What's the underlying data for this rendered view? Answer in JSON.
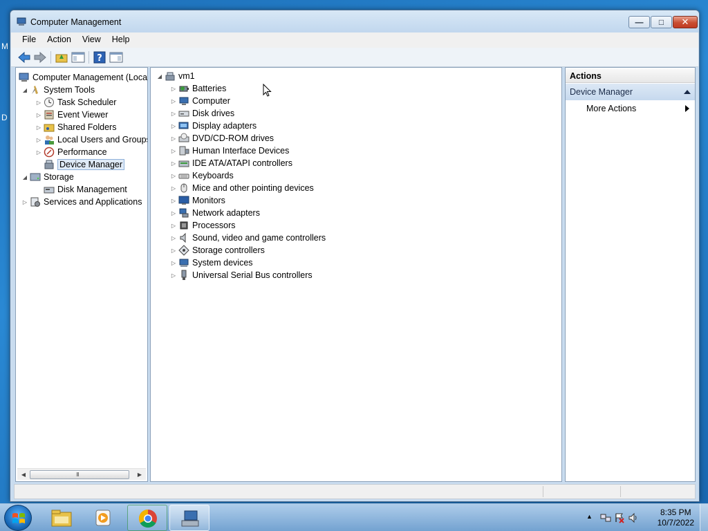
{
  "desktop": {
    "frag_top": "M",
    "frag_mid": "D"
  },
  "window": {
    "title": "Computer Management",
    "minimize_glyph": "—",
    "maximize_glyph": "□",
    "close_glyph": "✕"
  },
  "menu": {
    "file": "File",
    "action": "Action",
    "view": "View",
    "help": "Help"
  },
  "tree": {
    "root": "Computer Management (Local",
    "system_tools": "System Tools",
    "task_scheduler": "Task Scheduler",
    "event_viewer": "Event Viewer",
    "shared_folders": "Shared Folders",
    "local_users": "Local Users and Groups",
    "performance": "Performance",
    "device_manager": "Device Manager",
    "storage": "Storage",
    "disk_management": "Disk Management",
    "services": "Services and Applications"
  },
  "devices": {
    "root": "vm1",
    "items": [
      {
        "label": "Batteries",
        "icon": "battery-icon"
      },
      {
        "label": "Computer",
        "icon": "computer-icon"
      },
      {
        "label": "Disk drives",
        "icon": "disk-drive-icon"
      },
      {
        "label": "Display adapters",
        "icon": "display-adapter-icon"
      },
      {
        "label": "DVD/CD-ROM drives",
        "icon": "dvd-icon"
      },
      {
        "label": "Human Interface Devices",
        "icon": "hid-icon"
      },
      {
        "label": "IDE ATA/ATAPI controllers",
        "icon": "ide-icon"
      },
      {
        "label": "Keyboards",
        "icon": "keyboard-icon"
      },
      {
        "label": "Mice and other pointing devices",
        "icon": "mouse-icon"
      },
      {
        "label": "Monitors",
        "icon": "monitor-icon"
      },
      {
        "label": "Network adapters",
        "icon": "network-icon"
      },
      {
        "label": "Processors",
        "icon": "processor-icon"
      },
      {
        "label": "Sound, video and game controllers",
        "icon": "speaker-icon"
      },
      {
        "label": "Storage controllers",
        "icon": "storage-controller-icon"
      },
      {
        "label": "System devices",
        "icon": "system-device-icon"
      },
      {
        "label": "Universal Serial Bus controllers",
        "icon": "usb-icon"
      }
    ]
  },
  "actions": {
    "header": "Actions",
    "section": "Device Manager",
    "more": "More Actions"
  },
  "taskbar": {
    "time": "8:35 PM",
    "date": "10/7/2022",
    "tray_arrow": "▲"
  },
  "scroll_grip": "III",
  "colors": {
    "accent": "#c9dcef",
    "selection": "#dfeaf7",
    "close": "#c94e32"
  }
}
